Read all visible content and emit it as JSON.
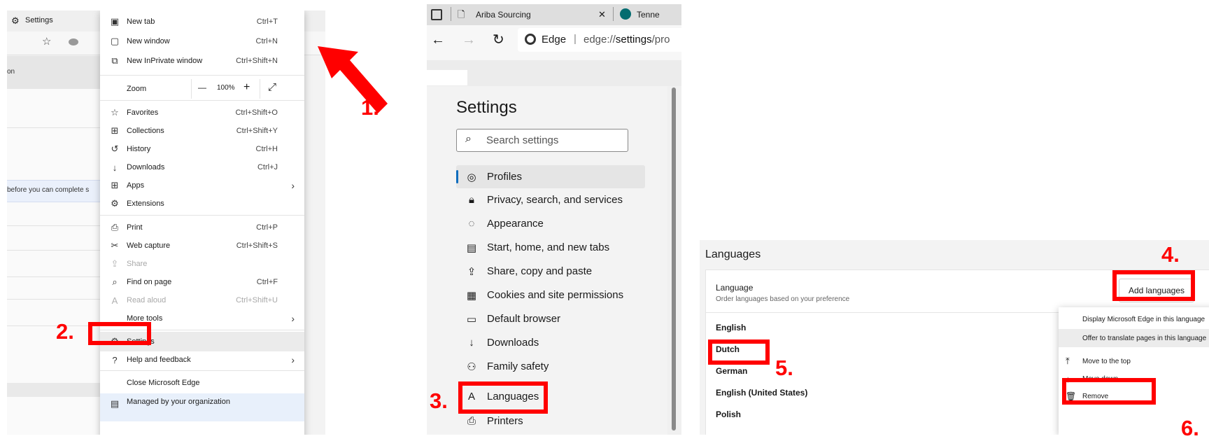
{
  "panel1": {
    "tab_title": "Settings",
    "menu_dots": "···",
    "close_glyph": "✕",
    "sidebar_fragment": "on",
    "banner_fragment": "before you can complete s",
    "menu": {
      "new_tab": {
        "label": "New tab",
        "shortcut": "Ctrl+T"
      },
      "new_window": {
        "label": "New window",
        "shortcut": "Ctrl+N"
      },
      "new_inprivate": {
        "label": "New InPrivate window",
        "shortcut": "Ctrl+Shift+N"
      },
      "zoom": {
        "label": "Zoom",
        "minus": "—",
        "value": "100%",
        "plus": "+",
        "expand": "⤢"
      },
      "favorites": {
        "label": "Favorites",
        "shortcut": "Ctrl+Shift+O"
      },
      "collections": {
        "label": "Collections",
        "shortcut": "Ctrl+Shift+Y"
      },
      "history": {
        "label": "History",
        "shortcut": "Ctrl+H"
      },
      "downloads": {
        "label": "Downloads",
        "shortcut": "Ctrl+J"
      },
      "apps": {
        "label": "Apps"
      },
      "extensions": {
        "label": "Extensions"
      },
      "print": {
        "label": "Print",
        "shortcut": "Ctrl+P"
      },
      "web_capture": {
        "label": "Web capture",
        "shortcut": "Ctrl+Shift+S"
      },
      "share": {
        "label": "Share"
      },
      "find_on_page": {
        "label": "Find on page",
        "shortcut": "Ctrl+F"
      },
      "read_aloud": {
        "label": "Read aloud",
        "shortcut": "Ctrl+Shift+U"
      },
      "more_tools": {
        "label": "More tools"
      },
      "settings": {
        "label": "Settings"
      },
      "help": {
        "label": "Help and feedback"
      },
      "close_edge": {
        "label": "Close Microsoft Edge"
      },
      "managed": {
        "label": "Managed by your organization"
      }
    }
  },
  "panel2": {
    "tab_title": "Ariba Sourcing",
    "tab_close": "✕",
    "tab2_title": "Tenne",
    "address_brand": "Edge",
    "address_sep": "|",
    "address_url_prefix": "edge://",
    "address_url_bold": "settings",
    "address_url_suffix": "/pro",
    "heading": "Settings",
    "search_placeholder": "Search settings",
    "nav": [
      {
        "label": "Profiles",
        "icon": "profiles-icon"
      },
      {
        "label": "Privacy, search, and services",
        "icon": "lock-icon"
      },
      {
        "label": "Appearance",
        "icon": "palette-icon"
      },
      {
        "label": "Start, home, and new tabs",
        "icon": "home-icon"
      },
      {
        "label": "Share, copy and paste",
        "icon": "share-icon"
      },
      {
        "label": "Cookies and site permissions",
        "icon": "cookies-icon"
      },
      {
        "label": "Default browser",
        "icon": "browser-icon"
      },
      {
        "label": "Downloads",
        "icon": "download-icon"
      },
      {
        "label": "Family safety",
        "icon": "family-icon"
      },
      {
        "label": "Languages",
        "icon": "language-icon"
      },
      {
        "label": "Printers",
        "icon": "printer-icon"
      }
    ]
  },
  "panel3": {
    "heading": "Languages",
    "card_title": "Language",
    "card_subtitle": "Order languages based on your preference",
    "add_button": "Add languages",
    "more_glyph": "···",
    "languages": [
      "English",
      "Dutch",
      "German",
      "English (United States)",
      "Polish"
    ],
    "context_menu": [
      "Display Microsoft Edge in this language",
      "Offer to translate pages in this language",
      "Move to the top",
      "Move down",
      "Remove"
    ]
  },
  "steps": [
    "1.",
    "2.",
    "3.",
    "4.",
    "5.",
    "6."
  ],
  "colors": {
    "annotation_red": "#ff0000",
    "accent_blue": "#0f6cbd"
  }
}
